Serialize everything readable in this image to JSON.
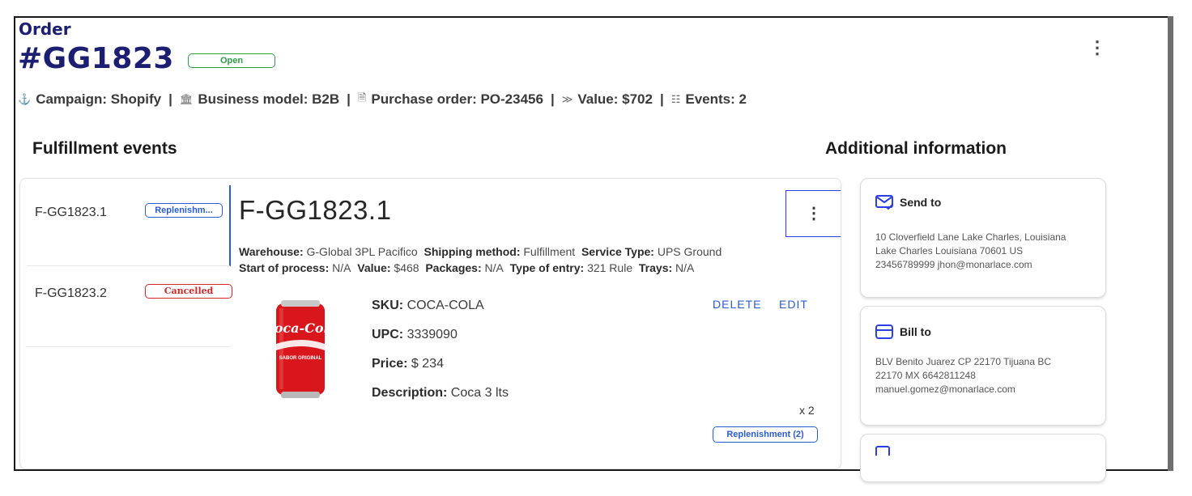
{
  "header": {
    "order_label": "Order",
    "order_id": "#GG1823",
    "status": "Open"
  },
  "meta": {
    "campaign": "Campaign: Shopify",
    "business_model": "Business model: B2B",
    "purchase_order": "Purchase order: PO-23456",
    "value": "Value: $702",
    "events": "Events: 2",
    "separator": "|"
  },
  "sections": {
    "fulfillment": "Fulfillment events",
    "additional": "Additional information"
  },
  "events": [
    {
      "name": "F-GG1823.1",
      "badge": "Replenishm..."
    },
    {
      "name": "F-GG1823.2",
      "badge": "Cancelled"
    }
  ],
  "detail": {
    "title": "F-GG1823.1",
    "warehouse_label": "Warehouse:",
    "warehouse": "G-Global 3PL Pacifico",
    "shipping_label": "Shipping method:",
    "shipping": "Fulfillment",
    "service_label": "Service Type:",
    "service": "UPS Ground",
    "start_label": "Start of process:",
    "start": "N/A",
    "value_label": "Value:",
    "value": "$468",
    "packages_label": "Packages:",
    "packages": "N/A",
    "entry_label": "Type of entry:",
    "entry": "321 Rule",
    "trays_label": "Trays:",
    "trays": "N/A"
  },
  "product": {
    "sku_label": "SKU:",
    "sku": "COCA-COLA",
    "upc_label": "UPC:",
    "upc": "3339090",
    "price_label": "Price:",
    "price": "$ 234",
    "description_label": "Description:",
    "description": "Coca 3 lts",
    "quantity": "x 2",
    "badge": "Replenishment (2)",
    "delete_label": "DELETE",
    "edit_label": "EDIT",
    "image_text": "Coca-Cola",
    "image_subtext": "SABOR ORIGINAL"
  },
  "send_to": {
    "title": "Send to",
    "line1": "10 Cloverfield Lane Lake Charles, Louisiana",
    "line2": "Lake Charles Louisiana 70601 US",
    "line3": "23456789999 jhon@monarlace.com"
  },
  "bill_to": {
    "title": "Bill to",
    "line1": "BLV Benito Juarez CP 22170 Tijuana BC",
    "line2": "22170 MX 6642811248",
    "line3": "manuel.gomez@monarlace.com"
  },
  "colors": {
    "brand": "#1c1e72",
    "accent": "#2a5bd7",
    "success": "#2e9e46",
    "danger": "#d42626"
  },
  "icons": [
    "anchor-icon",
    "building-icon",
    "document-icon",
    "money-icon",
    "list-icon",
    "mail-check-icon",
    "credit-card-icon",
    "more-vertical-icon"
  ]
}
